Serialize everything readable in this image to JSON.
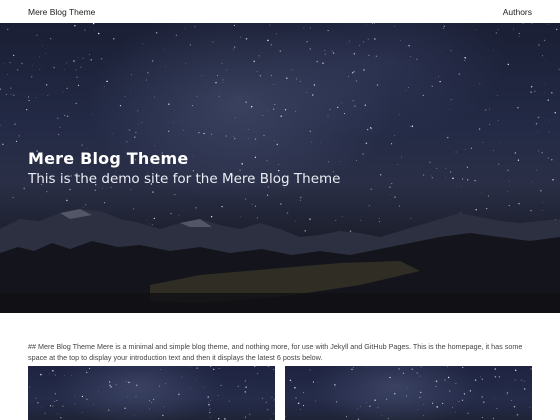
{
  "nav": {
    "site_title": "Mere Blog Theme",
    "authors_link": "Authors"
  },
  "hero": {
    "title": "Mere Blog Theme",
    "subtitle": "This is the demo site for the Mere Blog Theme"
  },
  "intro": {
    "text": "## Mere Blog Theme Mere is a minimal and simple blog theme, and nothing more, for use with Jekyll and GitHub Pages. This is the homepage, it has some space at the top to display your introduction text and then it displays the latest 6 posts below."
  },
  "posts": {
    "cards": [
      {
        "image": "starry-night-sky-image"
      },
      {
        "image": "starry-night-sky-image"
      }
    ]
  },
  "colors": {
    "nav_background": "#ffffff",
    "hero_text": "#ffffff",
    "body_text": "#444444"
  }
}
